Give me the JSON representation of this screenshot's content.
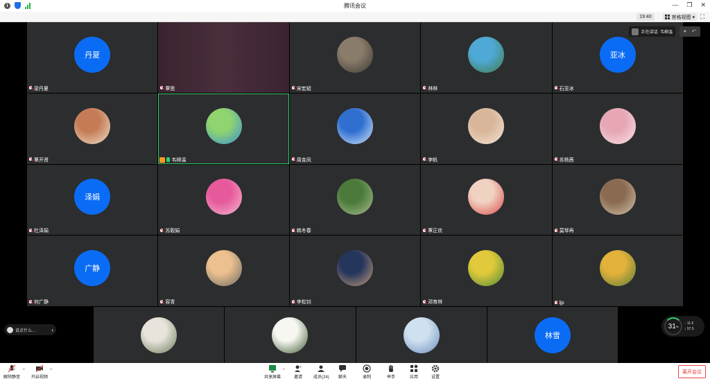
{
  "window": {
    "title": "腾讯会议"
  },
  "subbar": {
    "time": "19:40",
    "view_label": "宫格视图"
  },
  "speaking": {
    "label": "正在讲话: 韦柳温"
  },
  "grid": [
    {
      "name": "梁丹夏",
      "avatar_text": "丹夏",
      "avatar_kind": "blue"
    },
    {
      "name": "覃思",
      "avatar_text": "",
      "avatar_kind": "video"
    },
    {
      "name": "宋宏斌",
      "avatar_text": "",
      "avatar_kind": "photo",
      "colors": [
        "#8a7c6a",
        "#3c3a34"
      ]
    },
    {
      "name": "林林",
      "avatar_text": "",
      "avatar_kind": "photo",
      "colors": [
        "#4fa9d6",
        "#3f7c4a"
      ]
    },
    {
      "name": "石亚冰",
      "avatar_text": "亚冰",
      "avatar_kind": "blue"
    },
    {
      "name": "覃开贤",
      "avatar_text": "",
      "avatar_kind": "photo",
      "colors": [
        "#c57c56",
        "#efe0cc"
      ]
    },
    {
      "name": "韦柳温",
      "avatar_text": "",
      "avatar_kind": "photo",
      "colors": [
        "#8fd46f",
        "#3a8fd6"
      ],
      "active": true
    },
    {
      "name": "周金凤",
      "avatar_text": "",
      "avatar_kind": "photo",
      "colors": [
        "#2f6fd0",
        "#d6e6f7"
      ]
    },
    {
      "name": "李帆",
      "avatar_text": "",
      "avatar_kind": "photo",
      "colors": [
        "#d9b69a",
        "#f2e5d6"
      ]
    },
    {
      "name": "苏杨茜",
      "avatar_text": "",
      "avatar_kind": "photo",
      "colors": [
        "#e7a6b4",
        "#f7e4e8"
      ]
    },
    {
      "name": "杜泽娟",
      "avatar_text": "泽娟",
      "avatar_kind": "blue"
    },
    {
      "name": "苏毅娟",
      "avatar_text": "",
      "avatar_kind": "photo",
      "colors": [
        "#e65a9c",
        "#f4b9d2"
      ]
    },
    {
      "name": "韩冬春",
      "avatar_text": "",
      "avatar_kind": "photo",
      "colors": [
        "#4b7a3a",
        "#a7bd8f"
      ]
    },
    {
      "name": "覃正优",
      "avatar_text": "",
      "avatar_kind": "photo",
      "colors": [
        "#f0d2c2",
        "#d94a4a"
      ]
    },
    {
      "name": "莫琴再",
      "avatar_text": "",
      "avatar_kind": "photo",
      "colors": [
        "#8a6b52",
        "#d1c2a8"
      ]
    },
    {
      "name": "何广静",
      "avatar_text": "广静",
      "avatar_kind": "blue"
    },
    {
      "name": "容青",
      "avatar_text": "",
      "avatar_kind": "photo",
      "colors": [
        "#ecc08f",
        "#6a6a64"
      ]
    },
    {
      "name": "李松钊",
      "avatar_text": "",
      "avatar_kind": "photo",
      "colors": [
        "#24365c",
        "#c79b7a"
      ]
    },
    {
      "name": "邓育林",
      "avatar_text": "",
      "avatar_kind": "photo",
      "colors": [
        "#e0c93a",
        "#4c8a3a"
      ]
    },
    {
      "name": "ljp",
      "avatar_text": "",
      "avatar_kind": "photo",
      "colors": [
        "#e3b23a",
        "#5a7a3a"
      ]
    }
  ],
  "strip": [
    {
      "avatar_text": "",
      "avatar_kind": "photo",
      "colors": [
        "#e8e4dc",
        "#6b7c5a"
      ]
    },
    {
      "avatar_text": "",
      "avatar_kind": "photo",
      "colors": [
        "#f7f7f2",
        "#3d5a32"
      ]
    },
    {
      "avatar_text": "",
      "avatar_kind": "photo",
      "colors": [
        "#cfe0f0",
        "#6a8fba"
      ]
    },
    {
      "avatar_text": "林雪",
      "avatar_kind": "blue"
    }
  ],
  "chat": {
    "placeholder": "说点什么..."
  },
  "meter": {
    "percent": "31",
    "unit": "%",
    "up": "11.6",
    "down": "97.5"
  },
  "toolbar": {
    "mute": "解除静音",
    "video": "开启视频",
    "share": "共享屏幕",
    "invite": "邀请",
    "members": "成员(24)",
    "chat": "聊天",
    "record": "录制",
    "raise": "举手",
    "apps": "应用",
    "settings": "设置",
    "leave": "离开会议"
  }
}
